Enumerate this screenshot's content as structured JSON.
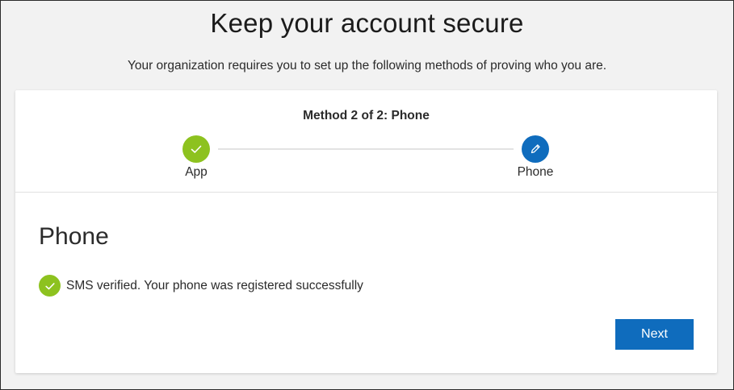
{
  "page": {
    "title": "Keep your account secure",
    "subtitle": "Your organization requires you to set up the following methods of proving who you are."
  },
  "stepper": {
    "header": "Method 2 of 2: Phone",
    "steps": [
      {
        "label": "App",
        "state": "completed",
        "icon": "checkmark-icon",
        "color": "#8dc21f"
      },
      {
        "label": "Phone",
        "state": "current",
        "icon": "pencil-icon",
        "color": "#0f6cbd"
      }
    ]
  },
  "section": {
    "title": "Phone",
    "status": {
      "icon": "checkmark-icon",
      "text": "SMS verified. Your phone was registered successfully"
    }
  },
  "actions": {
    "next_label": "Next"
  },
  "colors": {
    "accent": "#0f6cbd",
    "success": "#8dc21f",
    "background": "#f2f2f2"
  }
}
